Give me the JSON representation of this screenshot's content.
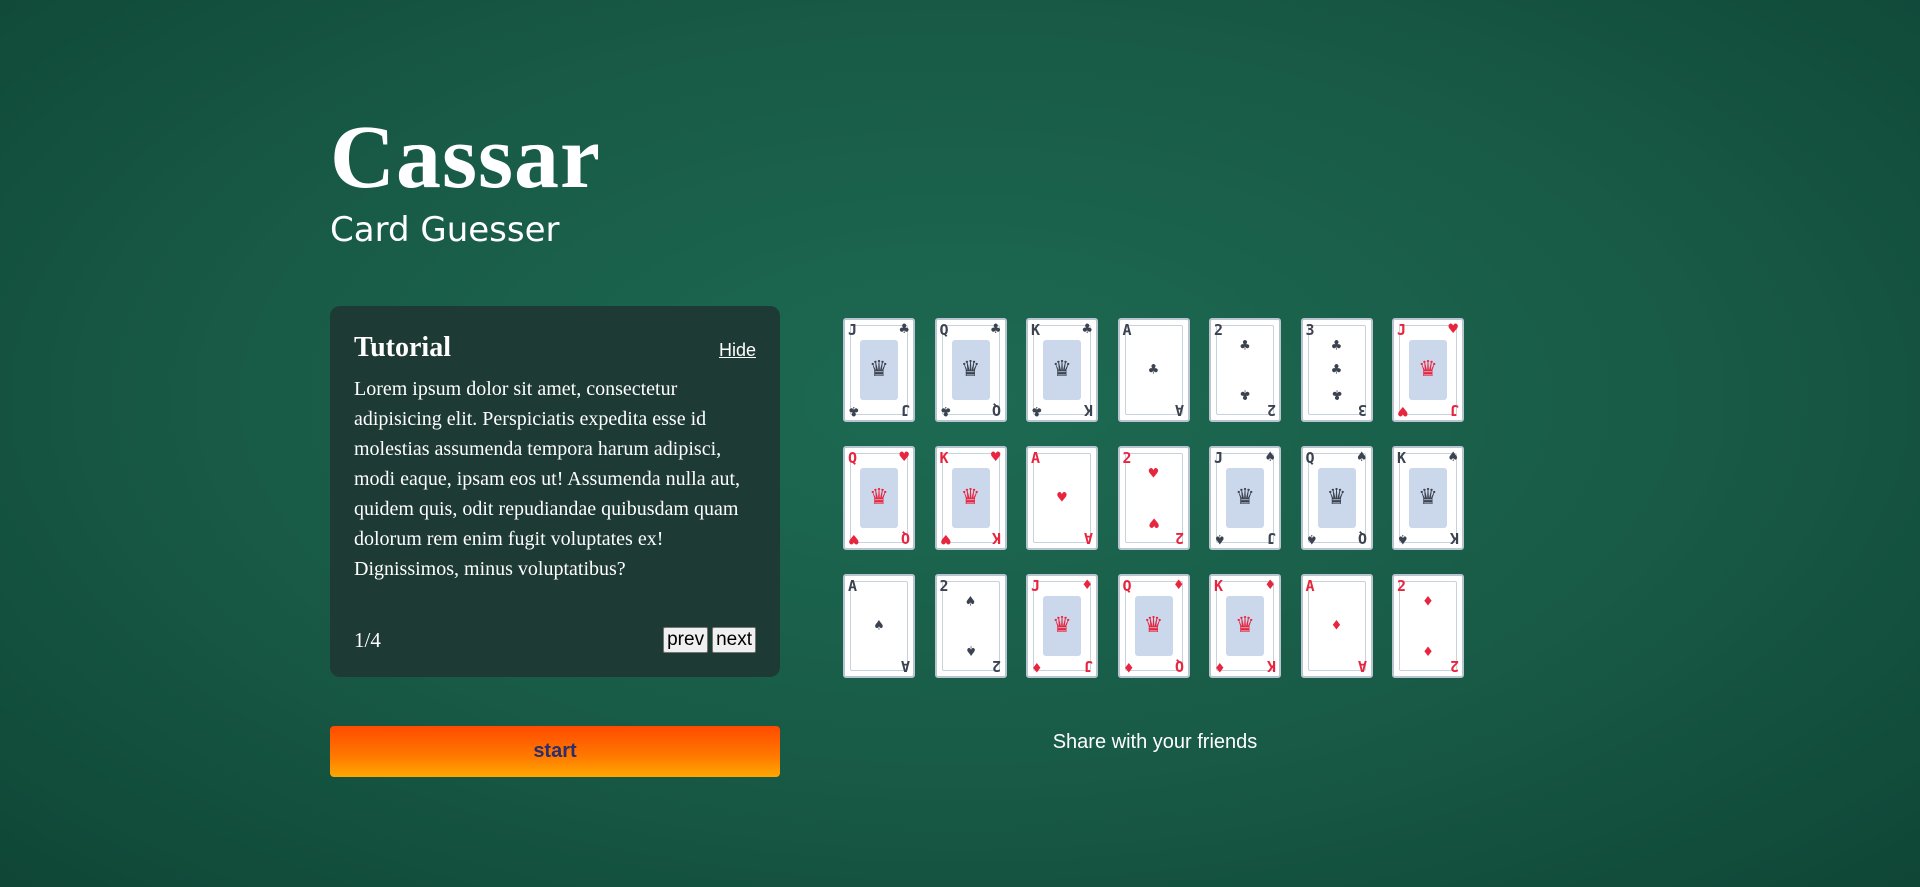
{
  "header": {
    "title": "Cassar",
    "subtitle": "Card Guesser"
  },
  "tutorial": {
    "title": "Tutorial",
    "hide_label": "Hide",
    "body": "Lorem ipsum dolor sit amet, consectetur adipisicing elit. Perspiciatis expedita esse id molestias assumenda tempora harum adipisci, modi eaque, ipsam eos ut! Assumenda nulla aut, quidem quis, odit repudiandae quibusdam quam dolorum rem enim fugit voluptates ex! Dignissimos, minus voluptatibus?",
    "page_indicator": "1/4",
    "prev_label": "prev",
    "next_label": "next"
  },
  "start_label": "start",
  "share_text": "Share with your friends",
  "colors": {
    "red_suit": "#e8253f",
    "black_suit": "#3b4250",
    "start_top": "#ff4a00",
    "start_bottom": "#ffa800"
  },
  "cards": [
    {
      "rank": "J",
      "suit": "clubs",
      "pip": "♣",
      "color": "black"
    },
    {
      "rank": "Q",
      "suit": "clubs",
      "pip": "♣",
      "color": "black"
    },
    {
      "rank": "K",
      "suit": "clubs",
      "pip": "♣",
      "color": "black"
    },
    {
      "rank": "A",
      "suit": "clubs",
      "pip": "♣",
      "color": "black"
    },
    {
      "rank": "2",
      "suit": "clubs",
      "pip": "♣",
      "color": "black"
    },
    {
      "rank": "3",
      "suit": "clubs",
      "pip": "♣",
      "color": "black"
    },
    {
      "rank": "J",
      "suit": "hearts",
      "pip": "♥",
      "color": "red"
    },
    {
      "rank": "Q",
      "suit": "hearts",
      "pip": "♥",
      "color": "red"
    },
    {
      "rank": "K",
      "suit": "hearts",
      "pip": "♥",
      "color": "red"
    },
    {
      "rank": "A",
      "suit": "hearts",
      "pip": "♥",
      "color": "red"
    },
    {
      "rank": "2",
      "suit": "hearts",
      "pip": "♥",
      "color": "red"
    },
    {
      "rank": "J",
      "suit": "spades",
      "pip": "♠",
      "color": "black"
    },
    {
      "rank": "Q",
      "suit": "spades",
      "pip": "♠",
      "color": "black"
    },
    {
      "rank": "K",
      "suit": "spades",
      "pip": "♠",
      "color": "black"
    },
    {
      "rank": "A",
      "suit": "spades",
      "pip": "♠",
      "color": "black"
    },
    {
      "rank": "2",
      "suit": "spades",
      "pip": "♠",
      "color": "black"
    },
    {
      "rank": "J",
      "suit": "diamonds",
      "pip": "♦",
      "color": "red"
    },
    {
      "rank": "Q",
      "suit": "diamonds",
      "pip": "♦",
      "color": "red"
    },
    {
      "rank": "K",
      "suit": "diamonds",
      "pip": "♦",
      "color": "red"
    },
    {
      "rank": "A",
      "suit": "diamonds",
      "pip": "♦",
      "color": "red"
    },
    {
      "rank": "2",
      "suit": "diamonds",
      "pip": "♦",
      "color": "red"
    }
  ]
}
